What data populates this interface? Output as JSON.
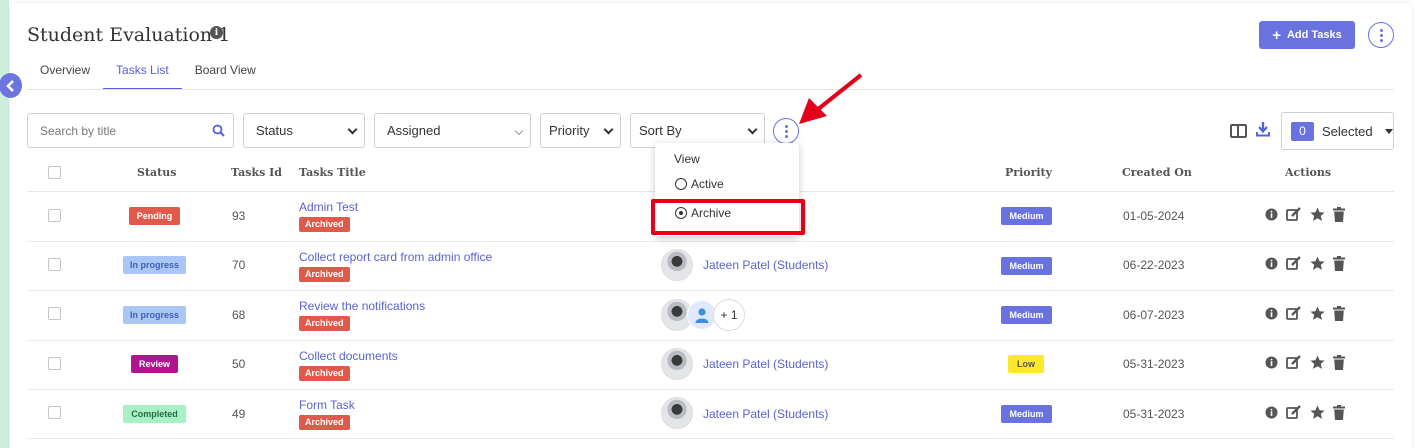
{
  "header": {
    "title": "Student Evaluation 1",
    "info_icon": "info-icon",
    "add_button": "Add Tasks",
    "more_icon": "more-vertical-icon"
  },
  "tabs": [
    {
      "label": "Overview",
      "active": false
    },
    {
      "label": "Tasks List",
      "active": true
    },
    {
      "label": "Board View",
      "active": false
    }
  ],
  "filters": {
    "search_placeholder": "Search by title",
    "status": "Status",
    "assigned": "Assigned",
    "priority": "Priority",
    "sort_by": "Sort By"
  },
  "toolbar": {
    "selected_count": "0",
    "selected_label": "Selected"
  },
  "view_menu": {
    "heading": "View",
    "options": [
      {
        "label": "Active",
        "selected": false
      },
      {
        "label": "Archive",
        "selected": true
      }
    ]
  },
  "table": {
    "columns": [
      "Status",
      "Tasks Id",
      "Tasks Title",
      "Priority",
      "Created On",
      "Actions"
    ],
    "rows": [
      {
        "status": "Pending",
        "id": "93",
        "title": "Admin Test",
        "tag": "Archived",
        "assignee": "",
        "priority": "Medium",
        "created": "01-05-2024"
      },
      {
        "status": "In progress",
        "id": "70",
        "title": "Collect report card from admin office",
        "tag": "Archived",
        "assignee": "Jateen Patel (Students)",
        "priority": "Medium",
        "created": "06-22-2023"
      },
      {
        "status": "In progress",
        "id": "68",
        "title": "Review the notifications",
        "tag": "Archived",
        "assignee": "",
        "extra_count": "+ 1",
        "priority": "Medium",
        "created": "06-07-2023"
      },
      {
        "status": "Review",
        "id": "50",
        "title": "Collect documents",
        "tag": "Archived",
        "assignee": "Jateen Patel (Students)",
        "priority": "Low",
        "created": "05-31-2023"
      },
      {
        "status": "Completed",
        "id": "49",
        "title": "Form Task",
        "tag": "Archived",
        "assignee": "Jateen Patel (Students)",
        "priority": "Medium",
        "created": "05-31-2023"
      }
    ]
  },
  "colors": {
    "accent": "#6a72e0",
    "pending": "#e05a4c",
    "in_progress": "#a9c6f5",
    "review": "#b0148f",
    "completed": "#a8f0c6",
    "medium": "#6a72e0",
    "low": "#fde82a",
    "highlight": "#e3001b"
  }
}
